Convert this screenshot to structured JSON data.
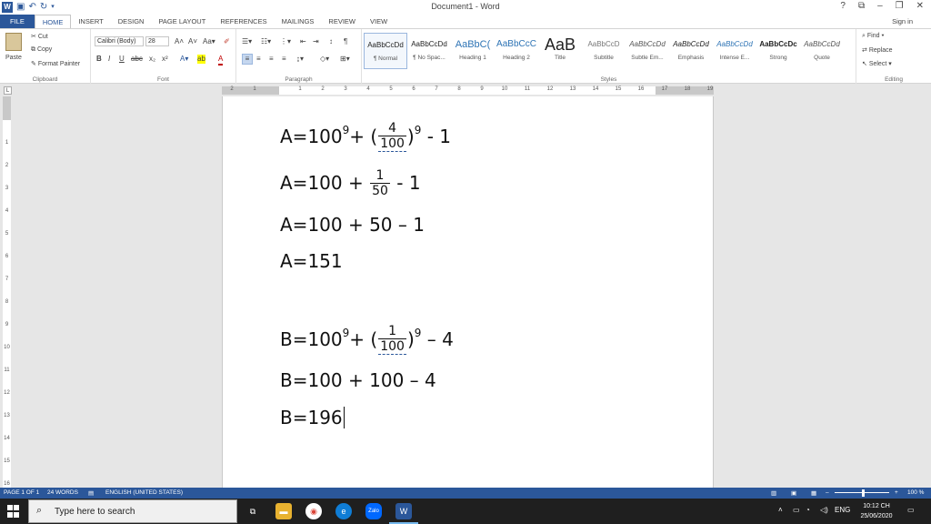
{
  "titlebar": {
    "title": "Document1 - Word",
    "undo_icon": "undo-icon",
    "redo_icon": "redo-icon",
    "controls": [
      "?",
      "⧉",
      "–",
      "❐",
      "✕"
    ]
  },
  "tabs": [
    {
      "label": "FILE"
    },
    {
      "label": "HOME"
    },
    {
      "label": "INSERT"
    },
    {
      "label": "DESIGN"
    },
    {
      "label": "PAGE LAYOUT"
    },
    {
      "label": "REFERENCES"
    },
    {
      "label": "MAILINGS"
    },
    {
      "label": "REVIEW"
    },
    {
      "label": "VIEW"
    }
  ],
  "signin": "Sign in",
  "clipboard": {
    "paste": "Paste",
    "cut": "Cut",
    "copy": "Copy",
    "format_painter": "Format Painter",
    "label": "Clipboard"
  },
  "font": {
    "name": "Calibri (Body)",
    "size": "28",
    "label": "Font"
  },
  "paragraph": {
    "label": "Paragraph"
  },
  "styles": {
    "label": "Styles",
    "items": [
      {
        "sample": "AaBbCcDd",
        "name": "¶ Normal"
      },
      {
        "sample": "AaBbCcDd",
        "name": "¶ No Spac..."
      },
      {
        "sample": "AaBbC(",
        "name": "Heading 1"
      },
      {
        "sample": "AaBbCcC",
        "name": "Heading 2"
      },
      {
        "sample": "AaB",
        "name": "Title"
      },
      {
        "sample": "AaBbCcD",
        "name": "Subtitle"
      },
      {
        "sample": "AaBbCcDd",
        "name": "Subtle Em..."
      },
      {
        "sample": "AaBbCcDd",
        "name": "Emphasis"
      },
      {
        "sample": "AaBbCcDd",
        "name": "Intense E..."
      },
      {
        "sample": "AaBbCcDc",
        "name": "Strong"
      },
      {
        "sample": "AaBbCcDd",
        "name": "Quote"
      }
    ]
  },
  "editing": {
    "find": "Find",
    "replace": "Replace",
    "select": "Select",
    "label": "Editing"
  },
  "ruler": {
    "h_numbers": [
      "2",
      "1",
      "1",
      "2",
      "3",
      "4",
      "5",
      "6",
      "7",
      "8",
      "9",
      "10",
      "11",
      "12",
      "13",
      "14",
      "15",
      "16",
      "17",
      "18",
      "19"
    ],
    "v_numbers": [
      "1",
      "2",
      "3",
      "4",
      "5",
      "6",
      "7",
      "8",
      "9",
      "10",
      "11",
      "12",
      "13",
      "14",
      "15",
      "16"
    ],
    "corner": "L"
  },
  "document": {
    "lines": [
      {
        "prefix": "A=100",
        "sup": "9",
        "plus": " + (",
        "num": "4",
        "den": "100",
        "close": ")",
        "sup2": "9",
        "tail": "- 1"
      },
      {
        "prefix": "A=100 + ",
        "num": "1",
        "den": "50",
        "tail": "- 1"
      },
      {
        "text": "A=100 + 50 – 1"
      },
      {
        "text": "A=151"
      },
      {
        "prefix": "B=100",
        "sup": "9",
        "plus": " + (",
        "num": "1",
        "den": "100",
        "close": ")",
        "sup2": "9",
        "tail": "– 4"
      },
      {
        "text": "B=100 + 100 – 4"
      },
      {
        "text": "B=196"
      }
    ]
  },
  "status": {
    "page": "PAGE 1 OF 1",
    "words": "24 WORDS",
    "language": "ENGLISH (UNITED STATES)",
    "zoom": "100 %"
  },
  "taskbar": {
    "search_placeholder": "Type here to search",
    "zalo": "Zalo",
    "word": "W",
    "lang": "ENG",
    "time": "10:12 CH",
    "date": "25/06/2020"
  },
  "colors": {
    "word_blue": "#2b579a",
    "taskbar": "#1f1f1f"
  }
}
